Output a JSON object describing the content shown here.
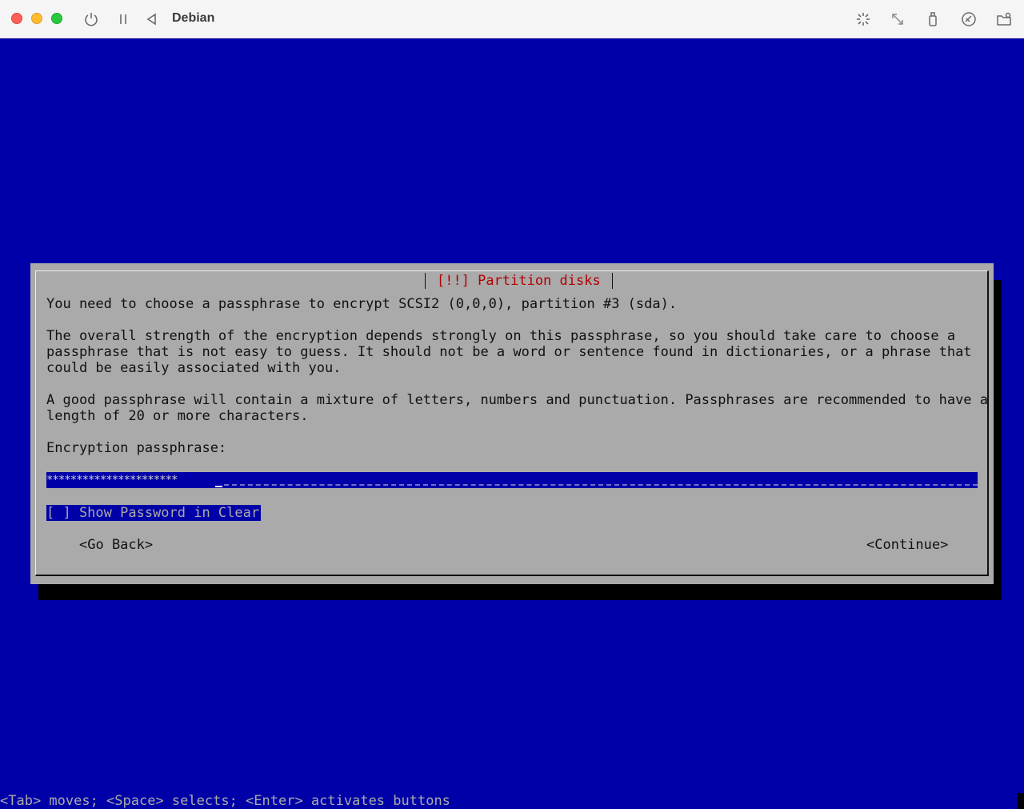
{
  "window": {
    "title": "Debian",
    "toolbar_icons": [
      "power-icon",
      "pause-icon",
      "back-triangle-icon",
      "brightness-icon",
      "resize-icon",
      "usb-icon",
      "network-icon",
      "shared-folder-icon"
    ]
  },
  "dialog": {
    "title": "[!!] Partition disks",
    "paragraph1": "You need to choose a passphrase to encrypt SCSI2 (0,0,0), partition #3 (sda).",
    "paragraph2_lines": [
      "The overall strength of the encryption depends strongly on this passphrase, so you should take care to choose a",
      "passphrase that is not easy to guess. It should not be a word or sentence found in dictionaries, or a phrase that",
      "could be easily associated with you."
    ],
    "paragraph3_lines": [
      "A good passphrase will contain a mixture of letters, numbers and punctuation. Passphrases are recommended to have a",
      "length of 20 or more characters."
    ],
    "field_label": "Encryption passphrase:",
    "passphrase_masked": "**********************",
    "checkbox_label": "[ ] Show Password in Clear",
    "go_back_label": "<Go Back>",
    "continue_label": "<Continue>"
  },
  "status_bar": "<Tab> moves; <Space> selects; <Enter> activates buttons",
  "colors": {
    "background": "#0000a8",
    "dialog": "#aaaaaa",
    "title_text": "#b20000"
  }
}
